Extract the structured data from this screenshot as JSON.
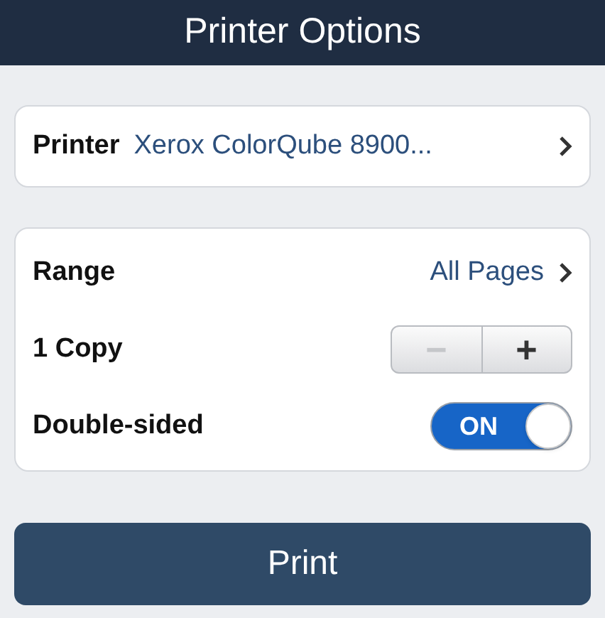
{
  "title": "Printer Options",
  "printer": {
    "label": "Printer",
    "value": "Xerox ColorQube 8900..."
  },
  "options": [
    {
      "kind": "link",
      "label": "Range",
      "value": "All Pages"
    },
    {
      "kind": "stepper",
      "label": "1 Copy",
      "buttons": [
        {
          "symbol": "−",
          "disabled": true
        },
        {
          "symbol": "+",
          "disabled": false
        }
      ]
    },
    {
      "kind": "toggle",
      "label": "Double-sided",
      "on": true,
      "text": "ON"
    }
  ],
  "print_button": "Print"
}
